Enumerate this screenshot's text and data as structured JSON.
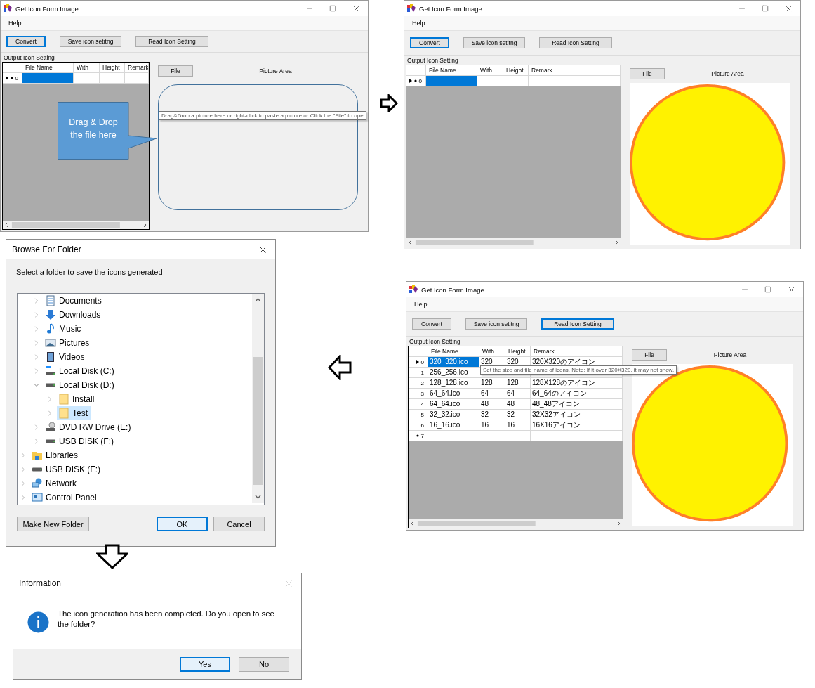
{
  "windows": [
    {
      "title": "Get Icon Form Image",
      "menu": [
        "Help"
      ],
      "buttons": [
        {
          "label": "Convert",
          "focused": true
        },
        {
          "label": "Save icon setitng",
          "focused": false
        },
        {
          "label": "Read Icon Setting",
          "focused": false
        }
      ],
      "section_label": "Output Icon  Setting",
      "table": {
        "columns": [
          "File Name",
          "With",
          "Height",
          "Remark"
        ],
        "rows": [
          {
            "kind": "current-new",
            "index": "0",
            "selected": true
          }
        ]
      },
      "file_button": "File",
      "picture_label": "Picture Area",
      "picture": {
        "kind": "drop-zone",
        "hint": "Drag&Drop a picture here or right-click to paste a picture or Click the \"File\" to ope"
      },
      "callout": "Drag & Drop the file here"
    },
    {
      "title": "Get Icon Form Image",
      "menu": [
        "Help"
      ],
      "buttons": [
        {
          "label": "Convert",
          "focused": true
        },
        {
          "label": "Save icon setitng",
          "focused": false
        },
        {
          "label": "Read Icon Setting",
          "focused": false
        }
      ],
      "section_label": "Output Icon  Setting",
      "table": {
        "columns": [
          "File Name",
          "With",
          "Height",
          "Remark"
        ],
        "rows": [
          {
            "kind": "current-new",
            "index": "0",
            "selected": true
          }
        ]
      },
      "file_button": "File",
      "picture_label": "Picture Area",
      "picture": {
        "kind": "picture"
      }
    },
    {
      "title": "Get Icon Form Image",
      "menu": [
        "Help"
      ],
      "buttons": [
        {
          "label": "Convert",
          "focused": false
        },
        {
          "label": "Save icon setitng",
          "focused": false
        },
        {
          "label": "Read Icon Setting",
          "focused": true
        }
      ],
      "section_label": "Output Icon  Setting",
      "table": {
        "columns": [
          "File Name",
          "With",
          "Height",
          "Remark"
        ],
        "rows": [
          {
            "kind": "current",
            "index": "0",
            "selected": true,
            "cells": [
              "320_320.ico",
              "320",
              "320",
              "320X320のアイコン"
            ]
          },
          {
            "kind": "normal",
            "index": "1",
            "selected": false,
            "cells": [
              "256_256.ico"
            ]
          },
          {
            "kind": "normal",
            "index": "2",
            "selected": false,
            "cells": [
              "128_128.ico",
              "128",
              "128",
              "128X128のアイコン"
            ]
          },
          {
            "kind": "normal",
            "index": "3",
            "selected": false,
            "cells": [
              "64_64.ico",
              "64",
              "64",
              "64_64のアイコン"
            ]
          },
          {
            "kind": "normal",
            "index": "4",
            "selected": false,
            "cells": [
              "64_64.ico",
              "48",
              "48",
              "48_48アイコン"
            ]
          },
          {
            "kind": "normal",
            "index": "5",
            "selected": false,
            "cells": [
              "32_32.ico",
              "32",
              "32",
              "32X32アイコン"
            ]
          },
          {
            "kind": "normal",
            "index": "6",
            "selected": false,
            "cells": [
              "16_16.ico",
              "16",
              "16",
              "16X16アイコン"
            ]
          },
          {
            "kind": "new",
            "index": "7",
            "selected": false
          }
        ]
      },
      "file_button": "File",
      "picture_label": "Picture Area",
      "picture": {
        "kind": "picture"
      },
      "tooltip": "Set the size and file name of icons. Note: If it over 320X320, it may not show."
    }
  ],
  "browse_dialog": {
    "title": "Browse For Folder",
    "prompt": "Select a folder to save the icons generated",
    "tree": [
      {
        "children": [
          {
            "label": "Documents",
            "kind": "documents",
            "expanded": false,
            "selected": false
          },
          {
            "label": "Downloads",
            "kind": "downloads",
            "expanded": false,
            "selected": false
          },
          {
            "label": "Music",
            "kind": "music",
            "expanded": false,
            "selected": false
          },
          {
            "label": "Pictures",
            "kind": "pictures",
            "expanded": false,
            "selected": false
          },
          {
            "label": "Videos",
            "kind": "videos",
            "expanded": false,
            "selected": false
          },
          {
            "label": "Local Disk (C:)",
            "kind": "system-disk",
            "expanded": false,
            "selected": false
          },
          {
            "label": "Local Disk (D:)",
            "kind": "disk",
            "expanded": true,
            "selected": false,
            "children": [
              {
                "label": "Install",
                "kind": "folder",
                "expanded": false,
                "selected": false
              },
              {
                "label": "Test",
                "kind": "folder",
                "expanded": false,
                "selected": true
              }
            ]
          },
          {
            "label": "DVD RW Drive (E:)",
            "kind": "dvd",
            "expanded": false,
            "selected": false
          },
          {
            "label": "USB DISK (F:)",
            "kind": "disk",
            "expanded": false,
            "selected": false
          }
        ]
      },
      {
        "label": "Libraries",
        "kind": "libraries",
        "expanded": false,
        "selected": false
      },
      {
        "label": "USB DISK (F:)",
        "kind": "disk",
        "expanded": false,
        "selected": false
      },
      {
        "label": "Network",
        "kind": "network",
        "expanded": false,
        "selected": false
      },
      {
        "label": "Control Panel",
        "kind": "control-panel",
        "expanded": false,
        "selected": false
      }
    ],
    "buttons": [
      {
        "label": "Make New Folder",
        "focused": false
      },
      {
        "label": "OK",
        "focused": true
      },
      {
        "label": "Cancel",
        "focused": false
      }
    ]
  },
  "info_dialog": {
    "title": "Information",
    "message": "The icon generation has been completed. Do you open to see the folder?",
    "buttons": [
      {
        "label": "Yes",
        "focused": true
      },
      {
        "label": "No",
        "focused": false
      }
    ]
  }
}
